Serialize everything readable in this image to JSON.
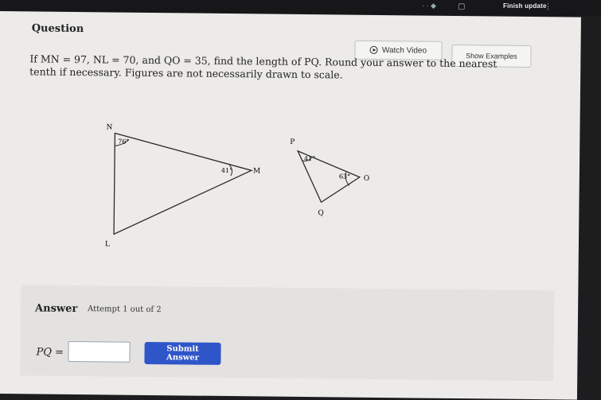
{
  "topbar": {
    "finish_label": "Finish update",
    "kebab": "⋮",
    "dots": "·      ·  ◆",
    "box": "▢"
  },
  "question": {
    "title": "Question",
    "watch_video": "Watch Video",
    "show_examples": "Show Examples",
    "text_line1": "If MN = 97, NL = 70, and QO = 35, find the length of PQ. Round your answer to the nearest",
    "text_line2": "tenth if necessary. Figures are not necessarily drawn to scale."
  },
  "figure1": {
    "vertex_N": "N",
    "vertex_L": "L",
    "vertex_M": "M",
    "angle_N": "76°",
    "angle_M": "41°"
  },
  "figure2": {
    "vertex_P": "P",
    "vertex_Q": "Q",
    "vertex_O": "O",
    "angle_P": "41°",
    "angle_O": "63°"
  },
  "answer": {
    "label": "Answer",
    "attempt": "Attempt 1 out of 2",
    "pq_label": "PQ =",
    "input_value": "",
    "submit": "Submit Answer"
  },
  "colors": {
    "accent": "#2f56c9",
    "page": "#ecebe9",
    "answer_panel": "#e3e2e0"
  }
}
